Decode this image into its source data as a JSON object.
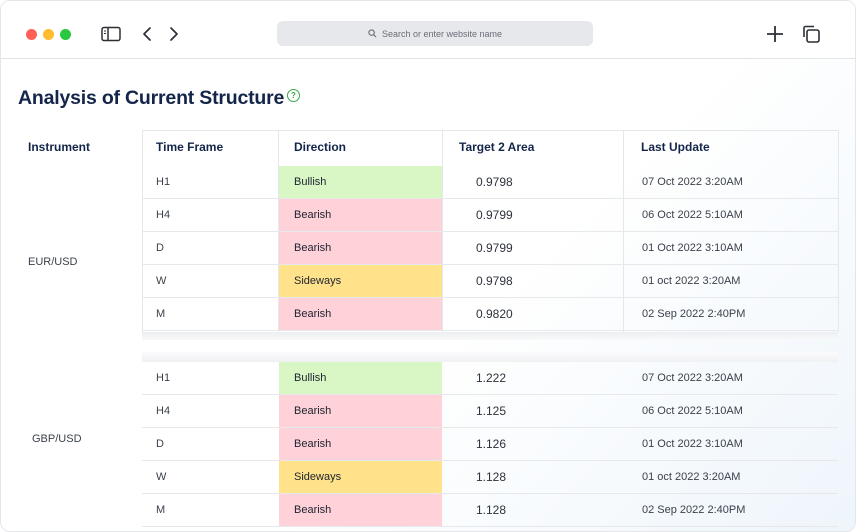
{
  "browser": {
    "address_placeholder": "Search or enter website name",
    "traffic_lights": {
      "close": "#ff5f57",
      "minimize": "#febc2e",
      "maximize": "#28c840"
    }
  },
  "page": {
    "title": "Analysis of Current Structure",
    "help_icon": "question-circle-icon"
  },
  "table": {
    "headers": {
      "instrument": "Instrument",
      "time_frame": "Time Frame",
      "direction": "Direction",
      "target": "Target 2 Area",
      "last_update": "Last Update"
    },
    "direction_colors": {
      "Bullish": "#d9f7c4",
      "Bearish": "#ffd1d8",
      "Sideways": "#ffe28a"
    },
    "groups": [
      {
        "instrument": "EUR/USD",
        "rows": [
          {
            "tf": "H1",
            "direction": "Bullish",
            "target": "0.9798",
            "updated": "07 Oct 2022 3:20AM"
          },
          {
            "tf": "H4",
            "direction": "Bearish",
            "target": "0.9799",
            "updated": "06 Oct 2022 5:10AM"
          },
          {
            "tf": "D",
            "direction": "Bearish",
            "target": "0.9799",
            "updated": "01 Oct 2022 3:10AM"
          },
          {
            "tf": "W",
            "direction": "Sideways",
            "target": "0.9798",
            "updated": "01 oct 2022 3:20AM"
          },
          {
            "tf": "M",
            "direction": "Bearish",
            "target": "0.9820",
            "updated": "02 Sep 2022 2:40PM"
          }
        ]
      },
      {
        "instrument": "GBP/USD",
        "rows": [
          {
            "tf": "H1",
            "direction": "Bullish",
            "target": "1.222",
            "updated": "07 Oct 2022 3:20AM"
          },
          {
            "tf": "H4",
            "direction": "Bearish",
            "target": "1.125",
            "updated": "06 Oct 2022 5:10AM"
          },
          {
            "tf": "D",
            "direction": "Bearish",
            "target": "1.126",
            "updated": "01 Oct 2022 3:10AM"
          },
          {
            "tf": "W",
            "direction": "Sideways",
            "target": "1.128",
            "updated": "01 oct 2022 3:20AM"
          },
          {
            "tf": "M",
            "direction": "Bearish",
            "target": "1.128",
            "updated": "02 Sep 2022 2:40PM"
          }
        ]
      }
    ]
  }
}
